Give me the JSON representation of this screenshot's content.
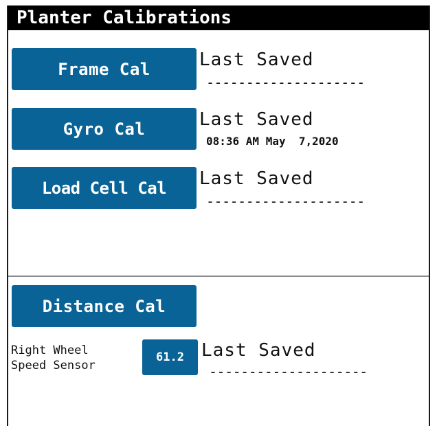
{
  "header": {
    "title": "Planter Calibrations"
  },
  "calibrations": [
    {
      "button_label": "Frame Cal",
      "last_saved_label": "Last Saved",
      "last_saved_value": "--------------------"
    },
    {
      "button_label": "Gyro Cal",
      "last_saved_label": "Last Saved",
      "last_saved_value": "08:36 AM May  7,2020"
    },
    {
      "button_label": "Load Cell Cal",
      "last_saved_label": "Last Saved",
      "last_saved_value": "--------------------"
    }
  ],
  "distance": {
    "button_label": "Distance Cal",
    "sensor_label": "Right Wheel\nSpeed Sensor",
    "sensor_value": "61.2",
    "last_saved_label": "Last Saved",
    "last_saved_value": "--------------------"
  },
  "colors": {
    "button_blue": "#0a6396",
    "title_bar": "#000000",
    "divider": "#8a8a8a"
  }
}
